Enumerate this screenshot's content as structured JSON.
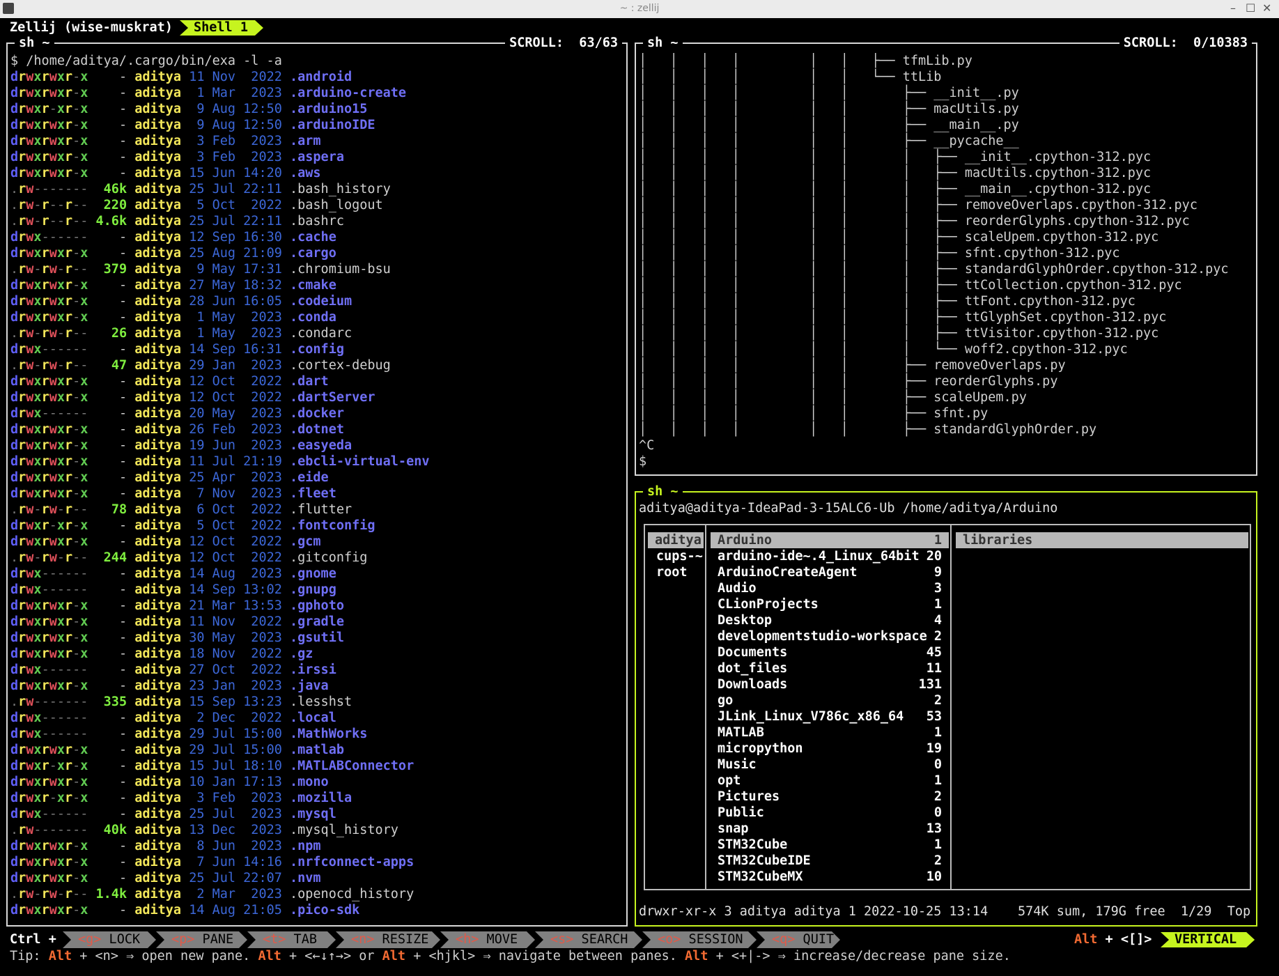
{
  "window": {
    "title": "~ : zellij",
    "controls": [
      "–",
      "☐",
      "✕"
    ]
  },
  "zellij_bar": {
    "session": "Zellij (wise-muskrat)",
    "tab": "Shell 1"
  },
  "left_pane": {
    "title": "sh ~",
    "scroll": "SCROLL:  63/63",
    "command": "$ /home/aditya/.cargo/bin/exa -l -a",
    "rows": [
      [
        "drwxrwxr-x",
        "-",
        "aditya",
        "11 Nov  2022",
        ".android",
        "d"
      ],
      [
        "drwxrwxr-x",
        "-",
        "aditya",
        " 1 Mar  2023",
        ".arduino-create",
        "d"
      ],
      [
        "drwxr-xr-x",
        "-",
        "aditya",
        " 9 Aug 12:50",
        ".arduino15",
        "d"
      ],
      [
        "drwxrwxr-x",
        "-",
        "aditya",
        " 9 Aug 12:50",
        ".arduinoIDE",
        "d"
      ],
      [
        "drwxrwxr-x",
        "-",
        "aditya",
        " 3 Feb  2023",
        ".arm",
        "d"
      ],
      [
        "drwxrwxr-x",
        "-",
        "aditya",
        " 3 Feb  2023",
        ".aspera",
        "d"
      ],
      [
        "drwxrwxr-x",
        "-",
        "aditya",
        "15 Jun 14:20",
        ".aws",
        "d"
      ],
      [
        ".rw-------",
        "46k",
        "aditya",
        "25 Jul 22:11",
        ".bash_history",
        "f"
      ],
      [
        ".rw-r--r--",
        "220",
        "aditya",
        " 5 Oct  2022",
        ".bash_logout",
        "f"
      ],
      [
        ".rw-r--r--",
        "4.6k",
        "aditya",
        "25 Jul 22:11",
        ".bashrc",
        "f"
      ],
      [
        "drwx------",
        "-",
        "aditya",
        "12 Sep 16:30",
        ".cache",
        "d"
      ],
      [
        "drwxrwxr-x",
        "-",
        "aditya",
        "25 Aug 21:09",
        ".cargo",
        "d"
      ],
      [
        ".rw-rw-r--",
        "379",
        "aditya",
        " 9 May 17:31",
        ".chromium-bsu",
        "f"
      ],
      [
        "drwxrwxr-x",
        "-",
        "aditya",
        "27 May 18:32",
        ".cmake",
        "d"
      ],
      [
        "drwxrwxr-x",
        "-",
        "aditya",
        "28 Jun 16:05",
        ".codeium",
        "d"
      ],
      [
        "drwxrwxr-x",
        "-",
        "aditya",
        " 1 May  2023",
        ".conda",
        "d"
      ],
      [
        ".rw-rw-r--",
        "26",
        "aditya",
        " 1 May  2023",
        ".condarc",
        "f"
      ],
      [
        "drwx------",
        "-",
        "aditya",
        "14 Sep 16:31",
        ".config",
        "d"
      ],
      [
        ".rw-rw-r--",
        "47",
        "aditya",
        "29 Jan  2023",
        ".cortex-debug",
        "f"
      ],
      [
        "drwxrwxr-x",
        "-",
        "aditya",
        "12 Oct  2022",
        ".dart",
        "d"
      ],
      [
        "drwxrwxr-x",
        "-",
        "aditya",
        "12 Oct  2022",
        ".dartServer",
        "d"
      ],
      [
        "drwx------",
        "-",
        "aditya",
        "20 May  2023",
        ".docker",
        "d"
      ],
      [
        "drwxrwxr-x",
        "-",
        "aditya",
        "26 Feb  2023",
        ".dotnet",
        "d"
      ],
      [
        "drwxrwxr-x",
        "-",
        "aditya",
        "19 Jun  2023",
        ".easyeda",
        "d"
      ],
      [
        "drwxrwxr-x",
        "-",
        "aditya",
        "11 Jul 21:19",
        ".ebcli-virtual-env",
        "d"
      ],
      [
        "drwxrwxr-x",
        "-",
        "aditya",
        "25 Apr  2023",
        ".eide",
        "d"
      ],
      [
        "drwxrwxr-x",
        "-",
        "aditya",
        " 7 Nov  2023",
        ".fleet",
        "d"
      ],
      [
        ".rw-rw-r--",
        "78",
        "aditya",
        " 6 Oct  2022",
        ".flutter",
        "f"
      ],
      [
        "drwxr-xr-x",
        "-",
        "aditya",
        " 5 Oct  2022",
        ".fontconfig",
        "d"
      ],
      [
        "drwxrwxr-x",
        "-",
        "aditya",
        "12 Oct  2022",
        ".gcm",
        "d"
      ],
      [
        ".rw-rw-r--",
        "244",
        "aditya",
        "12 Oct  2022",
        ".gitconfig",
        "f"
      ],
      [
        "drwx------",
        "-",
        "aditya",
        "14 Aug  2023",
        ".gnome",
        "d"
      ],
      [
        "drwx------",
        "-",
        "aditya",
        "14 Sep 13:02",
        ".gnupg",
        "d"
      ],
      [
        "drwxrwxr-x",
        "-",
        "aditya",
        "21 Mar 13:53",
        ".gphoto",
        "d"
      ],
      [
        "drwxrwxr-x",
        "-",
        "aditya",
        "11 Nov  2022",
        ".gradle",
        "d"
      ],
      [
        "drwxrwxr-x",
        "-",
        "aditya",
        "30 May  2023",
        ".gsutil",
        "d"
      ],
      [
        "drwxrwxr-x",
        "-",
        "aditya",
        "18 Nov  2022",
        ".gz",
        "d"
      ],
      [
        "drwx------",
        "-",
        "aditya",
        "27 Oct  2022",
        ".irssi",
        "d"
      ],
      [
        "drwxrwxr-x",
        "-",
        "aditya",
        "23 Jan  2023",
        ".java",
        "d"
      ],
      [
        ".rw-------",
        "335",
        "aditya",
        "15 Sep 13:23",
        ".lesshst",
        "f"
      ],
      [
        "drwx------",
        "-",
        "aditya",
        " 2 Dec  2022",
        ".local",
        "d"
      ],
      [
        "drwx------",
        "-",
        "aditya",
        "29 Jul 15:00",
        ".MathWorks",
        "d"
      ],
      [
        "drwxrwxr-x",
        "-",
        "aditya",
        "29 Jul 15:00",
        ".matlab",
        "d"
      ],
      [
        "drwxr-xr-x",
        "-",
        "aditya",
        "15 Jul 18:10",
        ".MATLABConnector",
        "d"
      ],
      [
        "drwxrwxr-x",
        "-",
        "aditya",
        "10 Jan 17:13",
        ".mono",
        "d"
      ],
      [
        "drwxr-xr-x",
        "-",
        "aditya",
        " 3 Feb  2023",
        ".mozilla",
        "d"
      ],
      [
        "drwx------",
        "-",
        "aditya",
        "25 Jul  2023",
        ".mysql",
        "d"
      ],
      [
        ".rw-------",
        "40k",
        "aditya",
        "13 Dec  2023",
        ".mysql_history",
        "f"
      ],
      [
        "drwxrwxr-x",
        "-",
        "aditya",
        " 8 Jun  2023",
        ".npm",
        "d"
      ],
      [
        "drwxrwxr-x",
        "-",
        "aditya",
        " 7 Jun 14:16",
        ".nrfconnect-apps",
        "d"
      ],
      [
        "drwxrwxr-x",
        "-",
        "aditya",
        "25 Jul 22:07",
        ".nvm",
        "d"
      ],
      [
        ".rw-rw-r--",
        "1.4k",
        "aditya",
        " 2 Mar  2023",
        ".openocd_history",
        "f"
      ],
      [
        "drwxrwxr-x",
        "-",
        "aditya",
        "14 Aug 21:05",
        ".pico-sdk",
        "d"
      ]
    ]
  },
  "right_top_pane": {
    "title": "sh ~",
    "scroll": "SCROLL:  0/10383",
    "prefix": "│   │   │   │         │   ",
    "lines": [
      [
        "│   ├── ",
        "tfmLib.py"
      ],
      [
        "│   └── ",
        "ttLib"
      ],
      [
        "│       ├── ",
        "__init__.py"
      ],
      [
        "│       ├── ",
        "macUtils.py"
      ],
      [
        "│       ├── ",
        "__main__.py"
      ],
      [
        "│       ├── ",
        "__pycache__"
      ],
      [
        "│       │   ├── ",
        "__init__.cpython-312.pyc"
      ],
      [
        "│       │   ├── ",
        "macUtils.cpython-312.pyc"
      ],
      [
        "│       │   ├── ",
        "__main__.cpython-312.pyc"
      ],
      [
        "│       │   ├── ",
        "removeOverlaps.cpython-312.pyc"
      ],
      [
        "│       │   ├── ",
        "reorderGlyphs.cpython-312.pyc"
      ],
      [
        "│       │   ├── ",
        "scaleUpem.cpython-312.pyc"
      ],
      [
        "│       │   ├── ",
        "sfnt.cpython-312.pyc"
      ],
      [
        "│       │   ├── ",
        "standardGlyphOrder.cpython-312.pyc"
      ],
      [
        "│       │   ├── ",
        "ttCollection.cpython-312.pyc"
      ],
      [
        "│       │   ├── ",
        "ttFont.cpython-312.pyc"
      ],
      [
        "│       │   ├── ",
        "ttGlyphSet.cpython-312.pyc"
      ],
      [
        "│       │   ├── ",
        "ttVisitor.cpython-312.pyc"
      ],
      [
        "│       │   └── ",
        "woff2.cpython-312.pyc"
      ],
      [
        "│       ├── ",
        "removeOverlaps.py"
      ],
      [
        "│       ├── ",
        "reorderGlyphs.py"
      ],
      [
        "│       ├── ",
        "scaleUpem.py"
      ],
      [
        "│       ├── ",
        "sfnt.py"
      ],
      [
        "│       ├── ",
        "standardGlyphOrder.py"
      ]
    ],
    "interrupt": "^C",
    "prompt": "$"
  },
  "right_bottom_pane": {
    "title": "sh ~",
    "header": "aditya@aditya-IdeaPad-3-15ALC6-Ub /home/aditya/Arduino",
    "col1": {
      "selected": "aditya",
      "items": [
        "cups-~",
        "root"
      ]
    },
    "col2": {
      "selected": {
        "name": "Arduino",
        "count": "1"
      },
      "items": [
        [
          "arduino-ide~.4_Linux_64bit",
          "20"
        ],
        [
          "ArduinoCreateAgent",
          "9"
        ],
        [
          "Audio",
          "3"
        ],
        [
          "CLionProjects",
          "1"
        ],
        [
          "Desktop",
          "4"
        ],
        [
          "developmentstudio-workspace",
          "2"
        ],
        [
          "Documents",
          "45"
        ],
        [
          "dot_files",
          "11"
        ],
        [
          "Downloads",
          "131"
        ],
        [
          "go",
          "2"
        ],
        [
          "JLink_Linux_V786c_x86_64",
          "53"
        ],
        [
          "MATLAB",
          "1"
        ],
        [
          "micropython",
          "19"
        ],
        [
          "Music",
          "0"
        ],
        [
          "opt",
          "1"
        ],
        [
          "Pictures",
          "2"
        ],
        [
          "Public",
          "0"
        ],
        [
          "snap",
          "13"
        ],
        [
          "STM32Cube",
          "1"
        ],
        [
          "STM32CubeIDE",
          "2"
        ],
        [
          "STM32CubeMX",
          "10"
        ]
      ]
    },
    "col3": {
      "selected": "libraries"
    },
    "status_left": "drwxr-xr-x 3 aditya aditya 1 2022-10-25 13:14",
    "status_right": "574K sum, 179G free  1/29  Top"
  },
  "keybar": {
    "ctrl": "Ctrl +",
    "keys": [
      {
        "k": "<g>",
        "label": " LOCK "
      },
      {
        "k": "<p>",
        "label": " PANE "
      },
      {
        "k": "<t>",
        "label": " TAB "
      },
      {
        "k": "<n>",
        "label": " RESIZE "
      },
      {
        "k": "<h>",
        "label": " MOVE "
      },
      {
        "k": "<s>",
        "label": " SEARCH "
      },
      {
        "k": "<o>",
        "label": " SESSION "
      },
      {
        "k": "<q>",
        "label": " QUIT "
      }
    ],
    "alt": "Alt",
    "alt_keys": " + <[]> ",
    "mode": "VERTICAL"
  },
  "tip": {
    "prefix": "Tip: ",
    "alt": "Alt",
    "part1": " + <n> ⇒ open new pane. ",
    "part2": " + <←↓↑→> or ",
    "part3": " + <hjkl> ⇒ navigate between panes. ",
    "part4": " + <+|-> ⇒ increase/decrease pane size."
  },
  "colors": {
    "accent": "#c6f41f",
    "dir": "#6f6ff5",
    "size": "#7fee3f",
    "user": "#f2e65a",
    "date": "#3c67d8",
    "alt": "#f26a32"
  }
}
